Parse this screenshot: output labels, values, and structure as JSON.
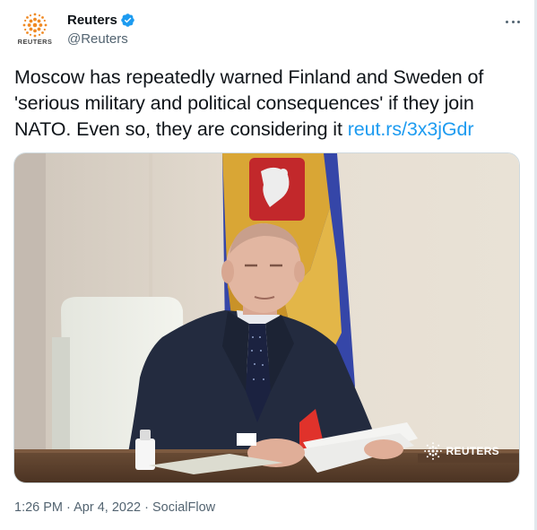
{
  "author": {
    "display_name": "Reuters",
    "handle": "@Reuters",
    "avatar_wordmark": "REUTERS",
    "verified": true
  },
  "tweet": {
    "text": "Moscow has repeatedly warned Finland and Sweden of 'serious military and political consequences' if they join NATO. Even so, they are considering it ",
    "link_text": "reut.rs/3x3jGdr"
  },
  "media": {
    "watermark": "REUTERS"
  },
  "meta": {
    "time": "1:26 PM",
    "separator": "·",
    "date": "Apr 4, 2022",
    "source": "SocialFlow"
  },
  "colors": {
    "accent": "#1d9bf0",
    "secondary_text": "#536471",
    "primary_text": "#0f1419"
  },
  "icons": {
    "avatar": "reuters-logo-icon",
    "verified": "verified-badge-icon",
    "more": "more-options-icon"
  }
}
